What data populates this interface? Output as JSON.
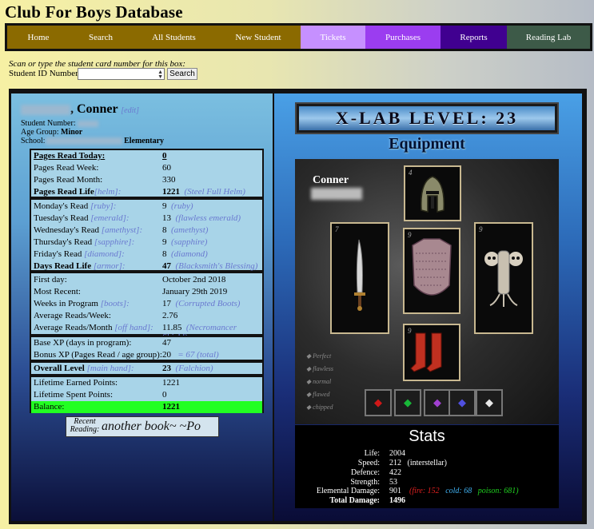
{
  "app_title": "Club For Boys Database",
  "nav": [
    {
      "label": "Home",
      "bg": "#8b6a00"
    },
    {
      "label": "Search",
      "bg": "#8b6a00"
    },
    {
      "label": "All Students",
      "bg": "#8b6a00"
    },
    {
      "label": "New Student",
      "bg": "#8b6a00"
    },
    {
      "label": "Tickets",
      "bg": "#c690ff"
    },
    {
      "label": "Purchases",
      "bg": "#9b3df0"
    },
    {
      "label": "Reports",
      "bg": "#400090"
    },
    {
      "label": "Reading Lab",
      "bg": "#3d5a48"
    }
  ],
  "scan_prompt": "Scan or type the student card number for this box:",
  "id_field": {
    "label": "Student ID Number",
    "value": ""
  },
  "search_button": "Search",
  "student": {
    "first_name": ", Conner",
    "edit": "[edit]",
    "number_label": "Student Number:",
    "age_group_label": "Age Group:",
    "age_group": "Minor",
    "school_label": "School:",
    "school_suffix": "Elementary"
  },
  "pages": {
    "today": {
      "label": "Pages Read Today:",
      "value": "0"
    },
    "week": {
      "label": "Pages Read Week:",
      "value": "60"
    },
    "month": {
      "label": "Pages Read Month:",
      "value": "330"
    },
    "life": {
      "label": "Pages Read Life",
      "slot": "[helm]:",
      "value": "1221",
      "item": "(Steel Full Helm)"
    }
  },
  "days": [
    {
      "label": "Monday's Read",
      "slot": "[ruby]:",
      "value": "9",
      "item": "(ruby)"
    },
    {
      "label": "Tuesday's Read",
      "slot": "[emerald]:",
      "value": "13",
      "item": "(flawless emerald)"
    },
    {
      "label": "Wednesday's Read",
      "slot": "[amethyst]:",
      "value": "8",
      "item": "(amethyst)"
    },
    {
      "label": "Thursday's Read",
      "slot": "[sapphire]:",
      "value": "9",
      "item": "(sapphire)"
    },
    {
      "label": "Friday's Read",
      "slot": "[diamond]:",
      "value": "8",
      "item": "(diamond)"
    }
  ],
  "days_life": {
    "label": "Days Read Life",
    "slot": "[armor]:",
    "value": "47",
    "item": "(Blacksmith's Blessing)"
  },
  "program": {
    "first_day": {
      "label": "First day:",
      "value": "October 2nd 2018"
    },
    "most_recent": {
      "label": "Most Recent:",
      "value": "January 29th 2019"
    },
    "weeks": {
      "label": "Weeks in Program",
      "slot": "[boots]:",
      "value": "17",
      "item": "(Corrupted Boots)"
    },
    "avg_week": {
      "label": "Average Reads/Week:",
      "value": "2.76"
    },
    "avg_month": {
      "label": "Average Reads/Month",
      "slot": "[off hand]:",
      "value": "11.85",
      "item": "(Necromancer Shield)"
    }
  },
  "xp": {
    "base": {
      "label": "Base XP (days in program):",
      "value": "47"
    },
    "bonus": {
      "label": "Bonus XP (Pages Read / age group):",
      "value": "20",
      "note": "= 67 (total)"
    }
  },
  "level": {
    "label": "Overall Level",
    "slot": "[main hand]:",
    "value": "23",
    "item": "(Falchion)"
  },
  "points": {
    "earned": {
      "label": "Lifetime Earned Points:",
      "value": "1221"
    },
    "spent": {
      "label": "Lifetime Spent Points:",
      "value": "0"
    },
    "balance": {
      "label": "Balance:",
      "value": "1221"
    }
  },
  "recent_reading": {
    "label": "Recent Reading:",
    "text": "another book~         ~Po"
  },
  "xlab": {
    "label": "X-LAB LEVEL: 23"
  },
  "equipment": {
    "title": "Equipment",
    "char_name": "Conner",
    "slots": [
      {
        "key": "helm",
        "level": "4",
        "icon": "helm-icon"
      },
      {
        "key": "weapon",
        "level": "7",
        "icon": "falchion-icon"
      },
      {
        "key": "armor",
        "level": "9",
        "icon": "armor-icon"
      },
      {
        "key": "shield",
        "level": "9",
        "icon": "skull-shield-icon"
      },
      {
        "key": "boots",
        "level": "9",
        "icon": "boots-icon"
      }
    ],
    "legend": [
      "Perfect",
      "flawless",
      "normal",
      "flawed",
      "chipped"
    ],
    "gems": [
      {
        "name": "ruby",
        "color": "#d01818"
      },
      {
        "name": "emerald",
        "color": "#18b838"
      },
      {
        "name": "amethyst",
        "color": "#a040d0"
      },
      {
        "name": "sapphire",
        "color": "#5050e0"
      },
      {
        "name": "diamond",
        "color": "#e8e8e8"
      }
    ]
  },
  "stats": {
    "title": "Stats",
    "life": {
      "label": "Life:",
      "value": "2004"
    },
    "speed": {
      "label": "Speed:",
      "value": "212",
      "note": "(interstellar)"
    },
    "defence": {
      "label": "Defence:",
      "value": "422"
    },
    "strength": {
      "label": "Strength:",
      "value": "53"
    },
    "elemental": {
      "label": "Elemental Damage:",
      "value": "901",
      "fire": "(fire: 152",
      "cold": "cold: 68",
      "poison": "poison: 681)"
    },
    "total": {
      "label": "Total Damage:",
      "value": "1496"
    }
  }
}
